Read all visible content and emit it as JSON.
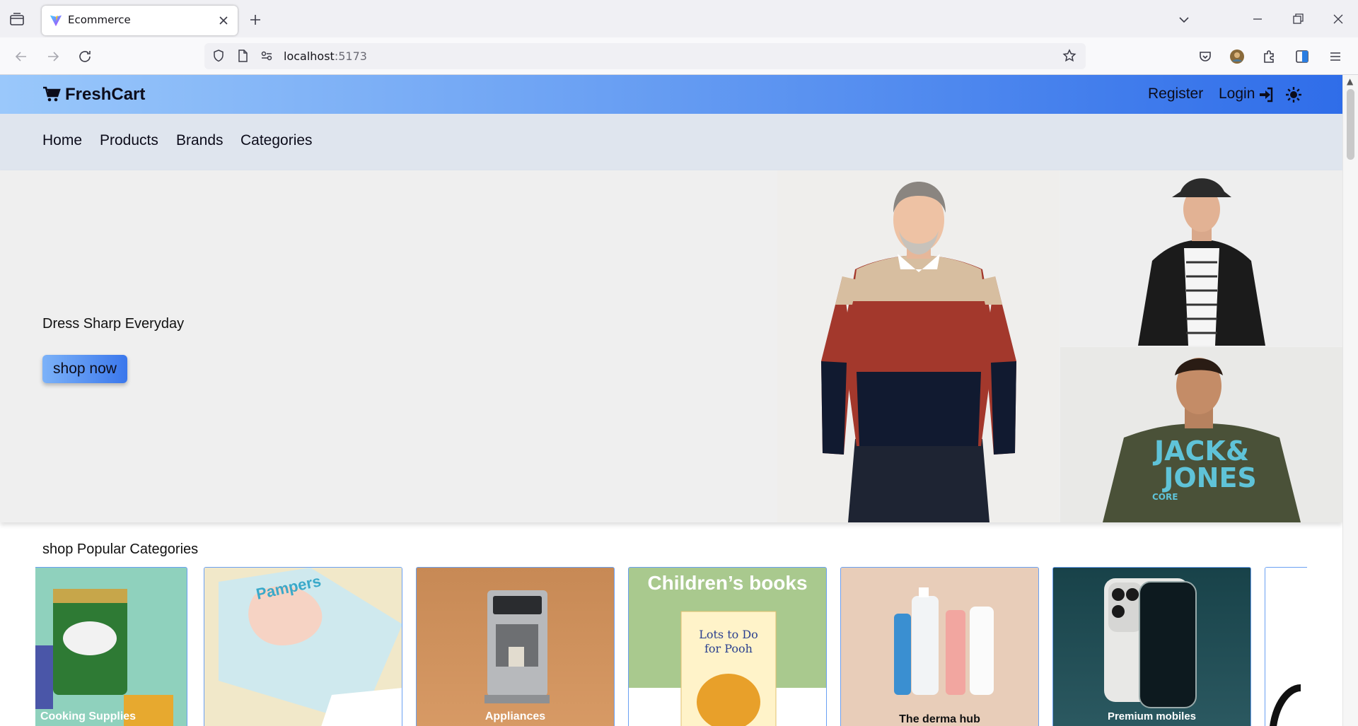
{
  "browser": {
    "tab_title": "Ecommerce",
    "url_host": "localhost",
    "url_port": ":5173"
  },
  "site": {
    "logo_text": "FreshCart",
    "header_links": {
      "register": "Register",
      "login": "Login"
    },
    "nav": [
      "Home",
      "Products",
      "Brands",
      "Categories"
    ]
  },
  "hero": {
    "tagline": "Dress Sharp Everyday",
    "button": "shop now",
    "side_shirt_text": "JACK&",
    "side_shirt_text2": "JONES",
    "side_shirt_text3": "CORE"
  },
  "categories": {
    "title": "shop Popular Categories",
    "items": [
      {
        "label": "Cooking Supplies"
      },
      {
        "label": ""
      },
      {
        "label": "Appliances"
      },
      {
        "label": "Children’s books"
      },
      {
        "label": "The derma hub"
      },
      {
        "label": "Premium mobiles"
      },
      {
        "label": ""
      }
    ]
  },
  "colors": {
    "header_gradient_start": "#9ac8fb",
    "header_gradient_end": "#2f6de9",
    "subnav_bg": "#dfe5ee",
    "card_border": "#6aa0f3"
  }
}
